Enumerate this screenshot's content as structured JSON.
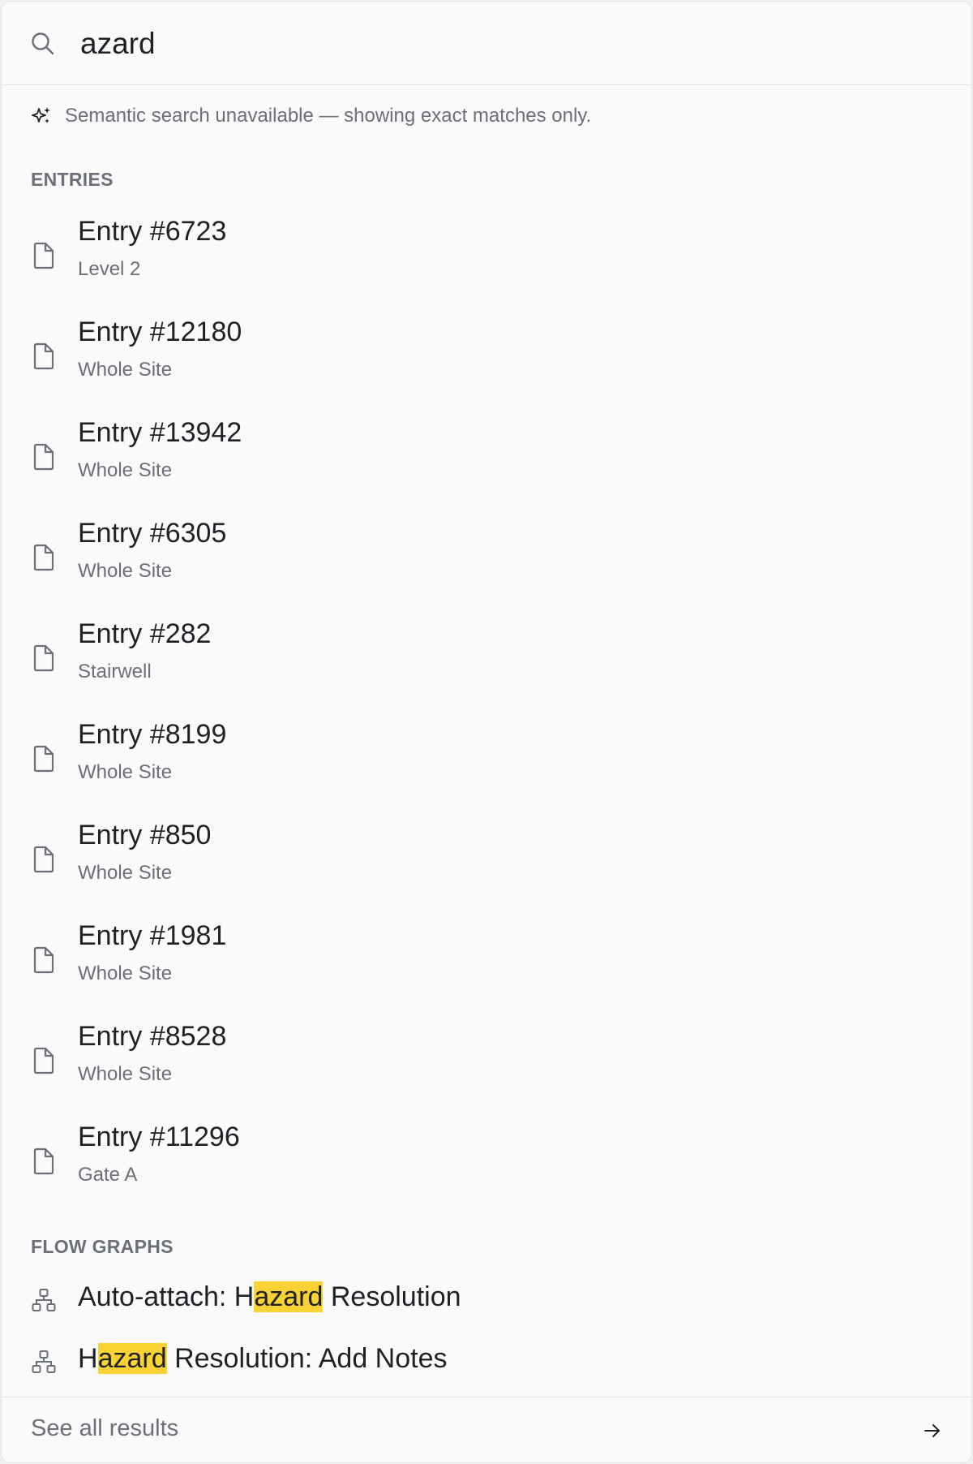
{
  "search": {
    "query": "azard",
    "icon": "search-icon"
  },
  "notice": {
    "icon": "sparkles-icon",
    "text": "Semantic search unavailable — showing exact matches only."
  },
  "entries_section": {
    "title": "ENTRIES",
    "items": [
      {
        "title": "Entry #6723",
        "location": "Level 2"
      },
      {
        "title": "Entry #12180",
        "location": "Whole Site"
      },
      {
        "title": "Entry #13942",
        "location": "Whole Site"
      },
      {
        "title": "Entry #6305",
        "location": "Whole Site"
      },
      {
        "title": "Entry #282",
        "location": "Stairwell"
      },
      {
        "title": "Entry #8199",
        "location": "Whole Site"
      },
      {
        "title": "Entry #850",
        "location": "Whole Site"
      },
      {
        "title": "Entry #1981",
        "location": "Whole Site"
      },
      {
        "title": "Entry #8528",
        "location": "Whole Site"
      },
      {
        "title": "Entry #11296",
        "location": "Gate A"
      }
    ]
  },
  "flow_graphs_section": {
    "title": "FLOW GRAPHS",
    "items": [
      {
        "before": "Auto-attach: H",
        "match": "azard",
        "after": " Resolution"
      },
      {
        "before": "H",
        "match": "azard",
        "after": " Resolution: Add Notes"
      }
    ]
  },
  "footer": {
    "label": "See all results",
    "icon": "arrow-right-icon"
  },
  "colors": {
    "highlight": "#f9d233",
    "muted_text": "#6b6f78",
    "primary_text": "#1f2126"
  }
}
